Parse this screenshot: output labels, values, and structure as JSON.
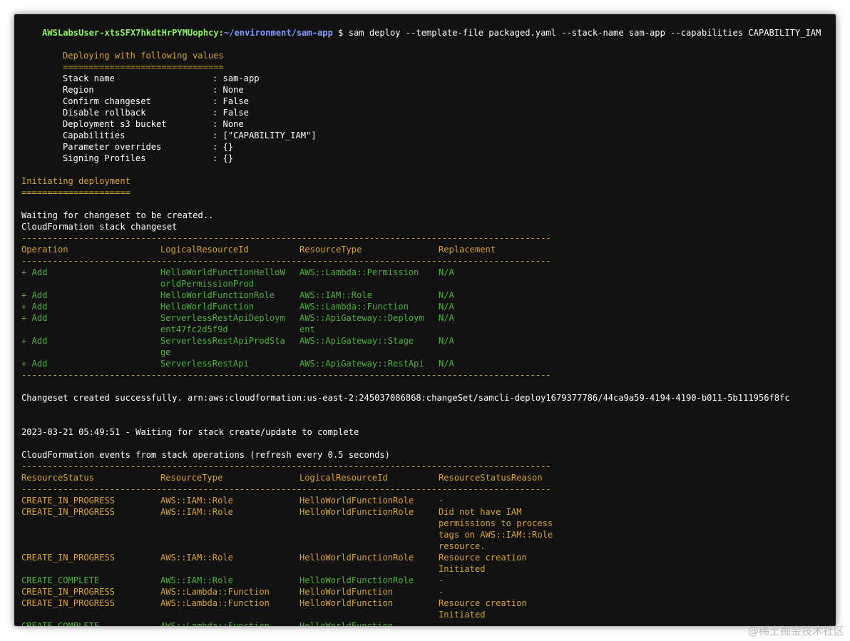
{
  "prompt": {
    "user_host": "AWSLabsUser-xtsSFX7hkdtHrPYMUophcy:",
    "path": "~/environment/sam-app",
    "command": " $ sam deploy --template-file packaged.yaml --stack-name sam-app --capabilities CAPABILITY_IAM"
  },
  "deploy_values": {
    "heading": "Deploying with following values",
    "underline": "===============================",
    "rows": [
      {
        "key": "Stack name",
        "value": ": sam-app"
      },
      {
        "key": "Region",
        "value": ": None"
      },
      {
        "key": "Confirm changeset",
        "value": ": False"
      },
      {
        "key": "Disable rollback",
        "value": ": False"
      },
      {
        "key": "Deployment s3 bucket",
        "value": ": None"
      },
      {
        "key": "Capabilities",
        "value": ": [\"CAPABILITY_IAM\"]"
      },
      {
        "key": "Parameter overrides",
        "value": ": {}"
      },
      {
        "key": "Signing Profiles",
        "value": ": {}"
      }
    ]
  },
  "initiating": {
    "heading": "Initiating deployment",
    "underline": "====================="
  },
  "changeset": {
    "waiting": "Waiting for changeset to be created..",
    "title": "CloudFormation stack changeset",
    "rule": "------------------------------------------------------------------------------------------------------",
    "headers": [
      "Operation",
      "LogicalResourceId",
      "ResourceType",
      "Replacement"
    ],
    "lines": [
      [
        "+ Add",
        "HelloWorldFunctionHelloW",
        "AWS::Lambda::Permission",
        "N/A"
      ],
      [
        "",
        "orldPermissionProd",
        "",
        ""
      ],
      [
        "+ Add",
        "HelloWorldFunctionRole",
        "AWS::IAM::Role",
        "N/A"
      ],
      [
        "+ Add",
        "HelloWorldFunction",
        "AWS::Lambda::Function",
        "N/A"
      ],
      [
        "+ Add",
        "ServerlessRestApiDeploym",
        "AWS::ApiGateway::Deploym",
        "N/A"
      ],
      [
        "",
        "ent47fc2d5f9d",
        "ent",
        ""
      ],
      [
        "+ Add",
        "ServerlessRestApiProdSta",
        "AWS::ApiGateway::Stage",
        "N/A"
      ],
      [
        "",
        "ge",
        "",
        ""
      ],
      [
        "+ Add",
        "ServerlessRestApi",
        "AWS::ApiGateway::RestApi",
        "N/A"
      ]
    ],
    "created": "Changeset created successfully. arn:aws:cloudformation:us-east-2:245037086868:changeSet/samcli-deploy1679377786/44ca9a59-4194-4190-b011-5b111956f8fc"
  },
  "status": {
    "waiting": "2023-03-21 05:49:51 - Waiting for stack create/update to complete"
  },
  "events": {
    "title": "CloudFormation events from stack operations (refresh every 0.5 seconds)",
    "rule": "------------------------------------------------------------------------------------------------------",
    "headers": [
      "ResourceStatus",
      "ResourceType",
      "LogicalResourceId",
      "ResourceStatusReason"
    ],
    "lines": [
      {
        "cells": [
          "CREATE_IN_PROGRESS",
          "AWS::IAM::Role",
          "HelloWorldFunctionRole",
          "-"
        ],
        "color": "y"
      },
      {
        "cells": [
          "CREATE_IN_PROGRESS",
          "AWS::IAM::Role",
          "HelloWorldFunctionRole",
          "Did not have IAM"
        ],
        "color": "y"
      },
      {
        "cells": [
          "",
          "",
          "",
          "permissions to process"
        ],
        "color": "y"
      },
      {
        "cells": [
          "",
          "",
          "",
          "tags on AWS::IAM::Role"
        ],
        "color": "y"
      },
      {
        "cells": [
          "",
          "",
          "",
          "resource."
        ],
        "color": "y"
      },
      {
        "cells": [
          "CREATE_IN_PROGRESS",
          "AWS::IAM::Role",
          "HelloWorldFunctionRole",
          "Resource creation"
        ],
        "color": "y"
      },
      {
        "cells": [
          "",
          "",
          "",
          "Initiated"
        ],
        "color": "y"
      },
      {
        "cells": [
          "CREATE_COMPLETE",
          "AWS::IAM::Role",
          "HelloWorldFunctionRole",
          "-"
        ],
        "color": "g"
      },
      {
        "cells": [
          "CREATE_IN_PROGRESS",
          "AWS::Lambda::Function",
          "HelloWorldFunction",
          "-"
        ],
        "color": "y"
      },
      {
        "cells": [
          "CREATE_IN_PROGRESS",
          "AWS::Lambda::Function",
          "HelloWorldFunction",
          "Resource creation"
        ],
        "color": "y"
      },
      {
        "cells": [
          "",
          "",
          "",
          "Initiated"
        ],
        "color": "y"
      },
      {
        "cells": [
          "CREATE_COMPLETE",
          "AWS::Lambda::Function",
          "HelloWorldFunction",
          "-"
        ],
        "color": "g"
      }
    ]
  },
  "watermark": "@稀土掘金技术社区",
  "colors": {
    "background": "#121212",
    "yellow": "#d7a530",
    "green": "#4fb23a",
    "prompt_user": "#8ff25f",
    "prompt_path": "#7f9cff",
    "text": "#ffffff"
  }
}
